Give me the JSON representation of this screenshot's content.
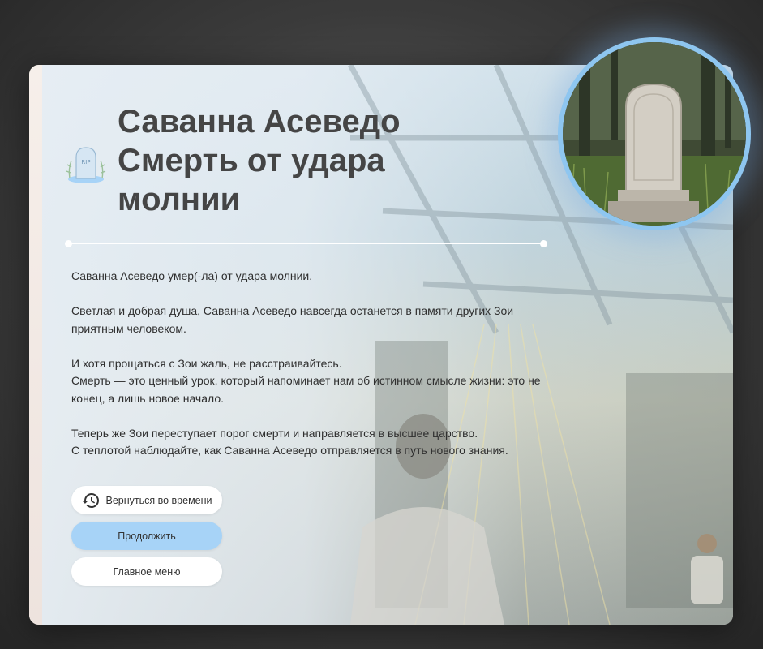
{
  "death_screen": {
    "title_lines": [
      "Саванна Асеведо",
      "Смерть от удара",
      "молнии"
    ],
    "icons": {
      "header": "rip-gravestone-icon",
      "portrait": "gravestone-portrait",
      "back_in_time": "history-clock-icon"
    },
    "paragraphs": [
      [
        "Саванна Асеведо умер(-ла) от удара молнии."
      ],
      [
        "Светлая и добрая душа, Саванна Асеведо навсегда останется в памяти других Зои приятным человеком."
      ],
      [
        "И хотя прощаться с Зои жаль, не расстраивайтесь.",
        "Смерть — это ценный урок, который напоминает нам об истинном смысле жизни: это не конец, а лишь новое начало."
      ],
      [
        "Теперь же Зои переступает порог смерти и направляется в высшее царство.",
        "С теплотой наблюдайте, как Саванна Асеведо отправляется в путь нового знания."
      ]
    ],
    "buttons": {
      "back_in_time": "Вернуться во времени",
      "continue": "Продолжить",
      "main_menu": "Главное меню"
    },
    "colors": {
      "accent": "#a7d3f7",
      "portrait_ring": "#8ec6f0",
      "title": "#454545"
    }
  }
}
